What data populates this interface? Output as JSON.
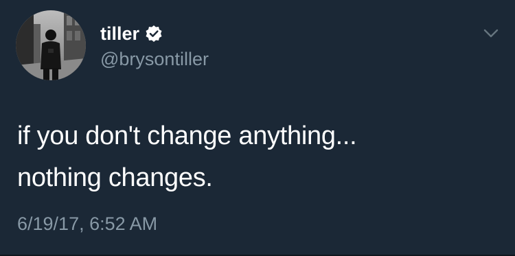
{
  "author": {
    "display_name": "tiller",
    "handle": "@brysontiller",
    "verified": true,
    "verified_icon": "verified-badge-icon",
    "avatar": "profile-photo"
  },
  "menu": {
    "icon": "chevron-down-icon"
  },
  "tweet": {
    "lines": [
      "if you don't change anything...",
      "nothing changes."
    ],
    "timestamp": "6/19/17, 6:52 AM"
  },
  "colors": {
    "background": "#1b2836",
    "primary_text": "#ffffff",
    "secondary_text": "#8899a6"
  }
}
